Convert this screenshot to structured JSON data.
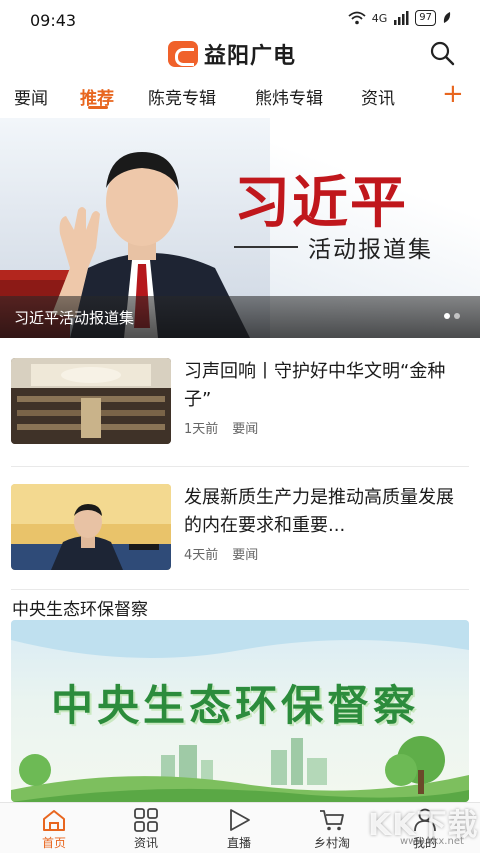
{
  "status_bar": {
    "time": "09:43",
    "signal": "4G",
    "battery": "97",
    "icons": [
      "wifi-icon",
      "signal-icon",
      "battery-icon",
      "leaf-icon"
    ]
  },
  "header": {
    "logo_text": "益阳广电",
    "search_icon": "search-icon"
  },
  "tabs": [
    {
      "label": "要闻",
      "active": false
    },
    {
      "label": "推荐",
      "active": true
    },
    {
      "label": "陈竞专辑",
      "active": false
    },
    {
      "label": "熊炜专辑",
      "active": false
    },
    {
      "label": "资讯",
      "active": false
    }
  ],
  "add_tab_label": "+",
  "banner": {
    "title": "习近平",
    "subtitle": "活动报道集",
    "caption": "习近平活动报道集",
    "slides": 2,
    "current_slide": 1
  },
  "news": [
    {
      "title": "习声回响丨守护好中华文明“金种子”",
      "time": "1天前",
      "category": "要闻"
    },
    {
      "title": "发展新质生产力是推动高质量发展的内在要求和重要...",
      "time": "4天前",
      "category": "要闻"
    }
  ],
  "section": {
    "title": "中央生态环保督察",
    "feature_text": "中央生态环保督察"
  },
  "bottom_nav": [
    {
      "label": "首页",
      "icon": "home-icon",
      "active": true
    },
    {
      "label": "资讯",
      "icon": "grid-icon",
      "active": false
    },
    {
      "label": "直播",
      "icon": "play-icon",
      "active": false
    },
    {
      "label": "乡村淘",
      "icon": "cart-icon",
      "active": false
    },
    {
      "label": "我的",
      "icon": "user-icon",
      "active": false
    }
  ],
  "watermark": {
    "text": "KK下载",
    "sub": "www.kkx.net"
  },
  "colors": {
    "accent": "#e8661f",
    "banner_red": "#c0171c",
    "feature_green": "#2c8c3c"
  }
}
